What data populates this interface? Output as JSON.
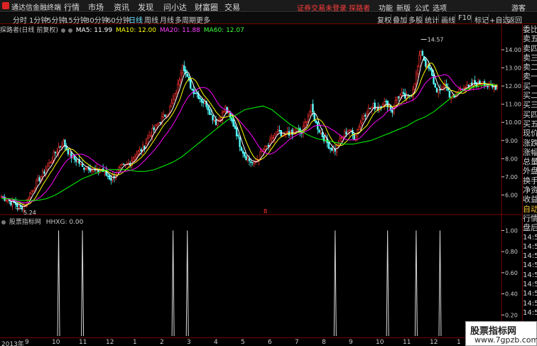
{
  "app": {
    "title": "通达信金融终端"
  },
  "menu": {
    "items": [
      "行情",
      "市场",
      "资讯",
      "发现",
      "问小达",
      "财富圈",
      "交易"
    ]
  },
  "notice": "证券交易未登录  探路者",
  "window_menu": {
    "items": [
      "功能",
      "新版",
      "公式",
      "选项",
      "游客"
    ]
  },
  "periods": {
    "items": [
      "分时",
      "1分钟",
      "5分钟",
      "15分钟",
      "30分钟",
      "60分钟",
      "日线",
      "周线",
      "月线",
      "多周期",
      "更多"
    ],
    "active": "日线"
  },
  "tools": {
    "items": [
      "复权",
      "叠加",
      "多股",
      "统计",
      "画线",
      "F10",
      "标记",
      "+自选",
      "返回"
    ]
  },
  "main_header": {
    "name": "探路者(日线 前复权)",
    "ma5_label": "MA5: 11.99",
    "ma10_label": "MA10: 12.00",
    "ma20_label": "MA20: 11.88",
    "ma60_label": "MA60: 12.07"
  },
  "colors": {
    "up": "#ff3232",
    "down": "#54ffff",
    "ma5": "#ffffff",
    "ma10": "#ffff00",
    "ma20": "#ff00ff",
    "ma60": "#00ff00",
    "grid": "#7a0000",
    "spike": "#d8d8d8"
  },
  "indicator_header": {
    "name": "股票指标网",
    "value_label": "HHXG: 0.00"
  },
  "right_panel": {
    "quote_labels": [
      "委比",
      "卖五",
      "卖四",
      "卖三",
      "卖二",
      "卖一",
      "买一",
      "买二",
      "买三",
      "买四",
      "买五",
      "现价",
      "涨跌",
      "涨幅",
      "总量",
      "外盘",
      "换手",
      "净资",
      "收益"
    ],
    "bottom_label": "自动",
    "tab_labels": [
      "行情",
      "盘后"
    ],
    "times": [
      "14:50",
      "14:50",
      "14:50",
      "14:50",
      "14:50",
      "14:50",
      "14:50",
      "14:50",
      "14:56"
    ]
  },
  "date_axis": {
    "labels": [
      "2013年",
      "9",
      "10",
      "11",
      "12",
      "1",
      "2",
      "3",
      "4",
      "5",
      "6",
      "7",
      "8",
      "9",
      "10",
      "11",
      "12",
      "1"
    ]
  },
  "watermark": {
    "line1": "股票指标网",
    "line2": "www.7gpzb.com"
  },
  "chart_data": [
    {
      "type": "candlestick",
      "title": "探路者(日线 前复权)",
      "y_ticks": [
        "14.00",
        "13.00",
        "12.00",
        "11.00",
        "10.00",
        "9.00",
        "8.00",
        "7.00",
        "6.00"
      ],
      "ylim": [
        5.0,
        14.9
      ],
      "annotations": {
        "high": "14.57",
        "low": "5.24",
        "marker": "B"
      },
      "close_path": [
        5.9,
        5.8,
        5.6,
        5.5,
        5.3,
        5.5,
        6.1,
        6.5,
        6.9,
        7.3,
        7.7,
        8.2,
        8.6,
        8.9,
        8.4,
        8.0,
        7.9,
        7.5,
        7.6,
        7.4,
        7.3,
        7.4,
        7.1,
        6.9,
        7.2,
        7.5,
        7.6,
        7.8,
        8.2,
        8.4,
        8.7,
        9.3,
        9.6,
        10.0,
        10.3,
        10.6,
        11.2,
        12.0,
        13.3,
        12.4,
        11.8,
        11.6,
        11.2,
        11.0,
        10.4,
        10.0,
        10.3,
        10.8,
        10.2,
        9.7,
        8.8,
        8.2,
        7.9,
        7.7,
        8.1,
        8.5,
        8.7,
        9.2,
        9.5,
        9.1,
        9.5,
        9.3,
        9.6,
        9.4,
        10.2,
        10.8,
        9.9,
        9.4,
        9.0,
        8.6,
        8.5,
        9.0,
        9.4,
        9.6,
        9.2,
        9.8,
        10.4,
        10.7,
        10.9,
        10.8,
        11.1,
        11.0,
        10.6,
        11.4,
        11.5,
        11.3,
        11.6,
        12.6,
        14.0,
        13.2,
        12.8,
        11.9,
        11.6,
        12.2,
        11.5,
        11.3,
        11.8,
        12.0,
        11.9,
        12.2,
        12.1,
        12.3,
        12.0,
        11.9,
        12.0
      ],
      "ma60_path": [
        5.8,
        5.8,
        5.7,
        5.7,
        5.7,
        5.8,
        6.0,
        6.3,
        6.6,
        6.9,
        7.1,
        7.3,
        7.4,
        7.4,
        7.4,
        7.3,
        7.3,
        7.4,
        7.6,
        7.8,
        8.1,
        8.5,
        8.9,
        9.3,
        9.7,
        10.1,
        10.4,
        10.7,
        10.8,
        10.9,
        10.7,
        10.3,
        9.9,
        9.6,
        9.3,
        9.1,
        9.0,
        8.9,
        8.8,
        8.8,
        8.9,
        9.0,
        9.2,
        9.4,
        9.6,
        9.8,
        10.1,
        10.3,
        10.6,
        11.0,
        11.4,
        11.7,
        11.9,
        12.0,
        12.05,
        12.07
      ]
    },
    {
      "type": "line",
      "title": "股票指标网",
      "y_ticks": [
        "1.00",
        "0.80",
        "0.60",
        "0.40",
        "0.20"
      ],
      "ylim": [
        0,
        1.05
      ],
      "signal_days": [
        12,
        17,
        36,
        39,
        70,
        81,
        87,
        92
      ]
    }
  ]
}
